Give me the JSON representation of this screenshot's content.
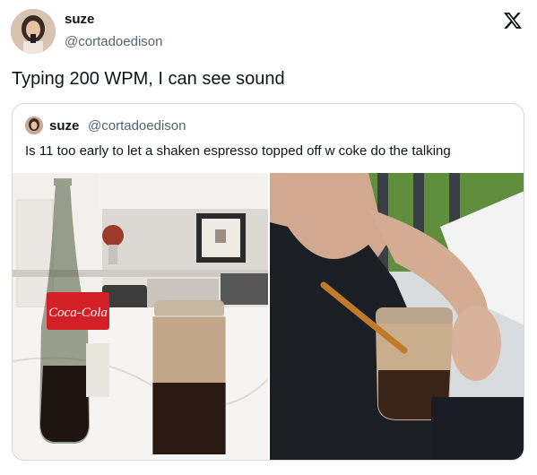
{
  "author": {
    "name": "suze",
    "handle": "@cortadoedison"
  },
  "brand_icon": "x-logo-icon",
  "tweet": {
    "text": "Typing 200 WPM, I can see sound"
  },
  "quoted": {
    "author": {
      "name": "suze",
      "handle": "@cortadoedison"
    },
    "text": "Is 11 too early to let a shaken espresso topped off w coke do the talking",
    "photos": [
      {
        "subject": "coca-cola-bottle-and-iced-espresso-jar"
      },
      {
        "subject": "person-holding-iced-coffee-jar-with-straw"
      }
    ],
    "bottle_label": "Coca-Cola"
  },
  "colors": {
    "text": "#0f1419",
    "secondary": "#536471",
    "border": "#cfd9de",
    "coke_red": "#d32027"
  }
}
